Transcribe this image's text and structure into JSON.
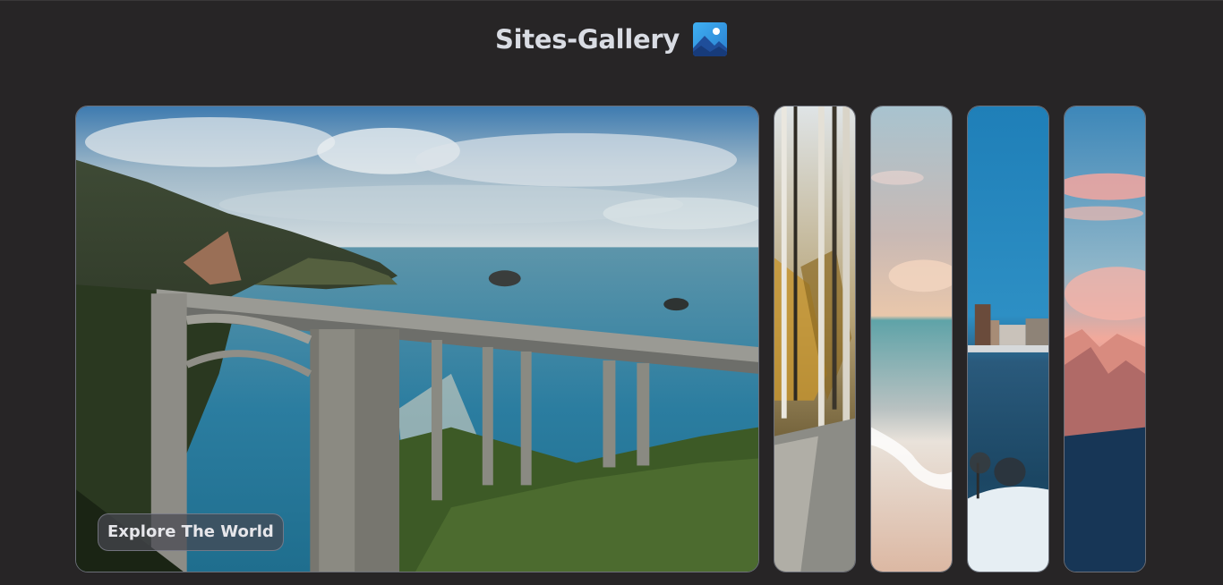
{
  "header": {
    "title": "Sites-Gallery",
    "icon": "landscape-picture-icon"
  },
  "gallery": {
    "featured": {
      "caption": "Explore The World",
      "image": "coastal-bridge-photo"
    },
    "thumbnails": [
      {
        "image": "birch-forest-path-photo"
      },
      {
        "image": "beach-sunset-photo"
      },
      {
        "image": "winter-city-lake-photo"
      },
      {
        "image": "pink-mountain-sky-photo"
      }
    ]
  },
  "colors": {
    "background": "#272526",
    "title": "#d9dce3",
    "panel_border": "#6c6f78"
  }
}
